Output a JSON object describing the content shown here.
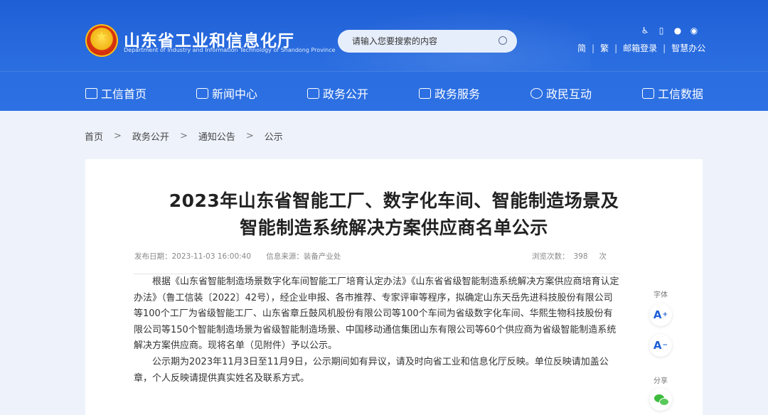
{
  "header": {
    "site_title": "山东省工业和信息化厅",
    "site_subtitle": "Department of Industry and Information Technology of Shandong Province",
    "search_placeholder": "请输入您要搜索的内容",
    "top_icons": [
      "accessibility-icon",
      "mobile-icon",
      "wechat-icon",
      "weibo-icon"
    ],
    "top_links": {
      "simplified": "简",
      "traditional": "繁",
      "mail_login": "邮箱登录",
      "smart_office": "智慧办公"
    },
    "nav": [
      {
        "label": "工信首页",
        "icon": "home-icon"
      },
      {
        "label": "新闻中心",
        "icon": "news-icon"
      },
      {
        "label": "政务公开",
        "icon": "monitor-icon"
      },
      {
        "label": "政务服务",
        "icon": "service-icon"
      },
      {
        "label": "政民互动",
        "icon": "interaction-icon"
      },
      {
        "label": "工信数据",
        "icon": "database-icon"
      }
    ],
    "colors": {
      "header_bg": "#2a6de0",
      "page_bg": "#eef3fb"
    }
  },
  "breadcrumb": [
    "首页",
    "政务公开",
    "通知公告",
    "公示"
  ],
  "breadcrumb_separator": ">",
  "article": {
    "title_line1": "2023年山东省智能工厂、数字化车间、智能制造场景及",
    "title_line2": "智能制造系统解决方案供应商名单公示",
    "publish_label": "发布日期：",
    "publish_date": "2023-11-03 16:00:40",
    "source_label": "信息来源：",
    "source": "装备产业处",
    "views_label": "浏览次数：",
    "views": "398",
    "views_unit": "次",
    "paragraphs": [
      "根据《山东省智能制造场景数字化车间智能工厂培育认定办法》《山东省省级智能制造系统解决方案供应商培育认定办法》（鲁工信装〔2022〕42号），经企业申报、各市推荐、专家评审等程序，拟确定山东天岳先进科技股份有限公司等100个工厂为省级智能工厂、山东省章丘鼓风机股份有限公司等100个车间为省级数字化车间、华熙生物科技股份有限公司等150个智能制造场景为省级智能制造场景、中国移动通信集团山东有限公司等60个供应商为省级智能制造系统解决方案供应商。现将名单（见附件）予以公示。",
      "公示期为2023年11月3日至11月9日，公示期间如有异议，请及时向省工业和信息化厅反映。单位反映请加盖公章，个人反映请提供真实姓名及联系方式。"
    ]
  },
  "side_tools": {
    "font_label": "字体",
    "font_increase": "A",
    "font_increase_mark": "+",
    "font_decrease": "A",
    "font_decrease_mark": "−",
    "share_label": "分享"
  }
}
